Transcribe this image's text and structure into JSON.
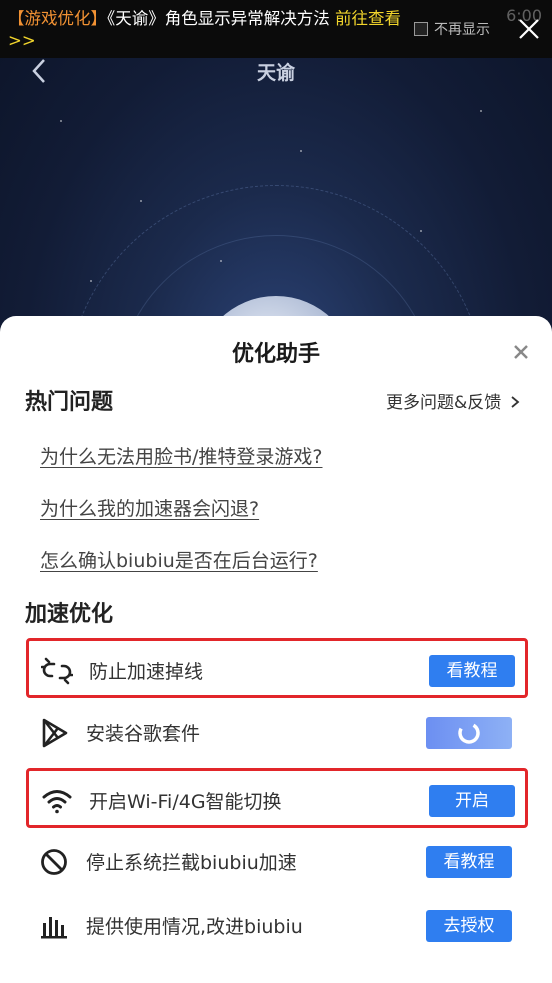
{
  "notification": {
    "tag": "【游戏优化】",
    "message": "《天谕》角色显示异常解决方法 ",
    "link": "前往查看>>",
    "dismiss_label": "不再显示",
    "time": "6:00"
  },
  "header": {
    "title": "天谕"
  },
  "sheet": {
    "title": "优化助手",
    "hot": {
      "title": "热门问题",
      "more_label": "更多问题&反馈",
      "questions": [
        "为什么无法用脸书/推特登录游戏?",
        "为什么我的加速器会闪退?",
        "怎么确认biubiu是否在后台运行?"
      ]
    },
    "accel": {
      "title": "加速优化",
      "items": [
        {
          "label": "防止加速掉线",
          "button": "看教程",
          "icon": "broken-link-icon",
          "highlighted": true
        },
        {
          "label": "安装谷歌套件",
          "button": "",
          "icon": "google-play-icon",
          "highlighted": false,
          "loading": true
        },
        {
          "label": "开启Wi-Fi/4G智能切换",
          "button": "开启",
          "icon": "wifi-icon",
          "highlighted": true
        },
        {
          "label": "停止系统拦截biubiu加速",
          "button": "看教程",
          "icon": "prohibit-icon",
          "highlighted": false
        },
        {
          "label": "提供使用情况,改进biubiu",
          "button": "去授权",
          "icon": "bar-chart-icon",
          "highlighted": false
        }
      ]
    }
  },
  "colors": {
    "accent": "#2f7ef0",
    "highlight_border": "#e2262a",
    "tag": "#f29233",
    "link": "#f2d52c"
  }
}
